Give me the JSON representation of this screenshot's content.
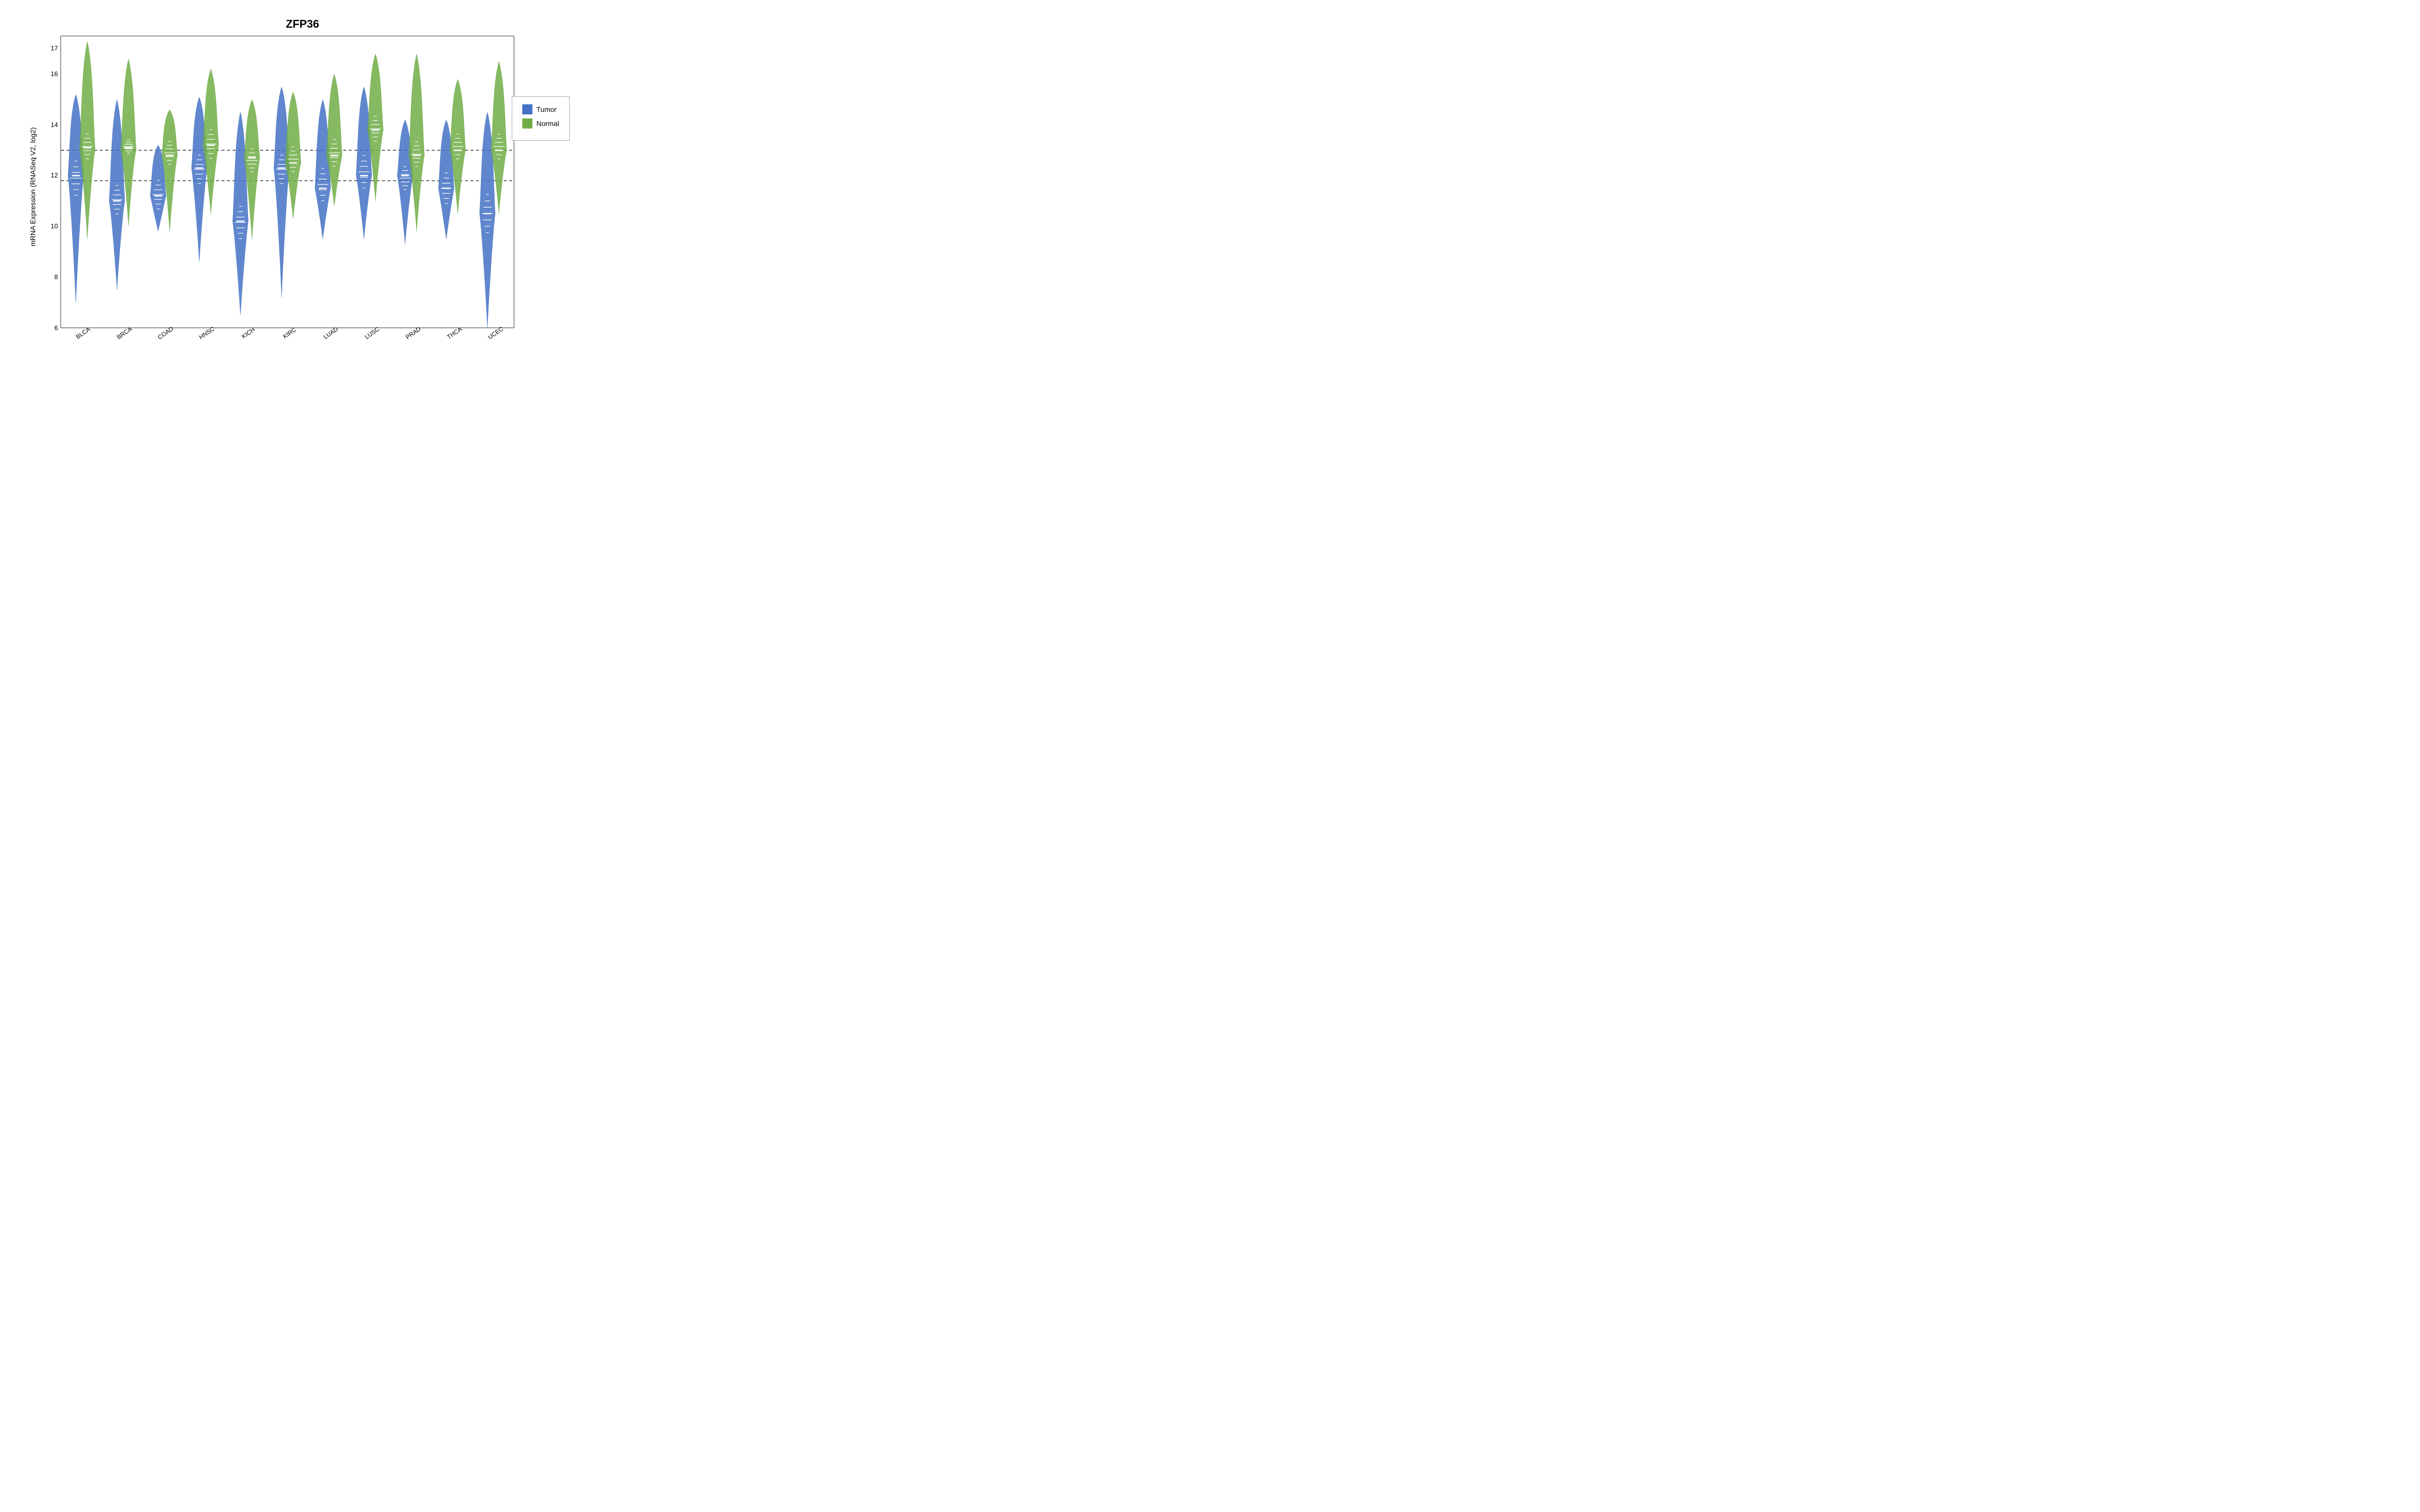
{
  "title": "ZFP36",
  "yaxis_label": "mRNA Expression (RNASeq V2, log2)",
  "y_ticks": [
    "17",
    "16",
    "14",
    "12",
    "10",
    "8",
    "6"
  ],
  "y_tick_values": [
    17,
    16,
    14,
    12,
    10,
    8,
    6
  ],
  "y_min": 6,
  "y_max": 17.5,
  "dashed_lines": [
    13.0,
    11.8
  ],
  "x_labels": [
    "BLCA",
    "BRCA",
    "COAD",
    "HNSC",
    "KICH",
    "KIRC",
    "LUAD",
    "LUSC",
    "PRAD",
    "THCA",
    "UCEC"
  ],
  "legend": {
    "items": [
      {
        "label": "Tumor",
        "color": "#4472C4"
      },
      {
        "label": "Normal",
        "color": "#70AD47"
      }
    ]
  },
  "tumor_color": "#4472C4",
  "normal_color": "#70AD47"
}
